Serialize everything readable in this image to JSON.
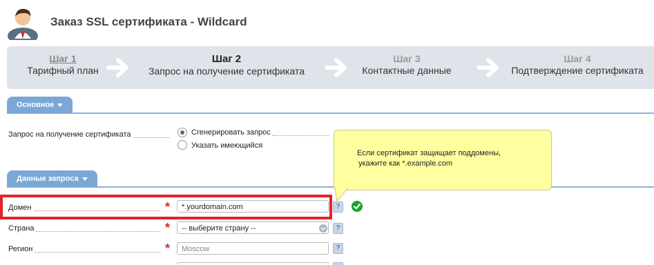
{
  "header": {
    "title": "Заказ SSL сертификата -  Wildcard"
  },
  "wizard": {
    "steps": [
      {
        "num": "Шаг 1",
        "label": "Тарифный план"
      },
      {
        "num": "Шаг 2",
        "label": "Запрос на получение сертификата"
      },
      {
        "num": "Шаг 3",
        "label": "Контактные данные"
      },
      {
        "num": "Шаг 4",
        "label": "Подтверждение сертификата"
      }
    ]
  },
  "sections": {
    "basic": "Основное",
    "request_data": "Данные запроса"
  },
  "form": {
    "csr_label": "Запрос на получение сертификата",
    "csr_option_generate": "Сгенерировать запрос",
    "csr_option_existing": "Указать имеющийся",
    "domain_label": "Домен",
    "domain_value": "*.yourdomain.com",
    "country_label": "Страна",
    "country_value": "-- выберите страну --",
    "region_label": "Регион",
    "region_placeholder": "Moscow",
    "help_glyph": "?",
    "required_glyph": "*"
  },
  "tooltip": {
    "line1": "Если сертификат  защищает поддомены,",
    "line2": "укажите как *.example.com"
  },
  "colors": {
    "tab_blue": "#7aa7d6",
    "required_red": "#e0262c",
    "highlight_red": "#e3222b",
    "tooltip_yellow": "#ffffa0",
    "ok_green": "#1aa62e"
  }
}
